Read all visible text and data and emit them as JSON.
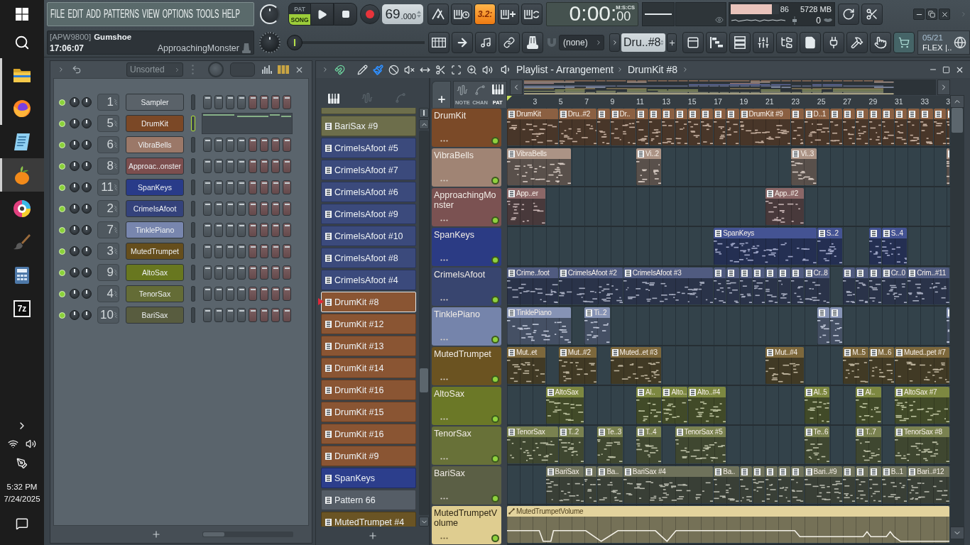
{
  "taskbar": {
    "apps": [
      {
        "kind": "folder",
        "running": true,
        "selected": false
      },
      {
        "kind": "globe",
        "running": true,
        "selected": false
      },
      {
        "kind": "notepad",
        "running": false,
        "selected": false
      },
      {
        "kind": "fruit",
        "running": true,
        "selected": true
      },
      {
        "kind": "disc",
        "running": false,
        "selected": false
      },
      {
        "kind": "brush",
        "running": false,
        "selected": false
      },
      {
        "kind": "calculator",
        "running": false,
        "selected": false
      },
      {
        "kind": "archive",
        "label": "7z",
        "running": false,
        "selected": false
      }
    ],
    "clock": {
      "time": "5:32 PM",
      "date": "7/24/2025"
    }
  },
  "menu": [
    "FILE",
    "EDIT",
    "ADD",
    "PATTERNS",
    "VIEW",
    "OPTIONS",
    "TOOLS",
    "HELP"
  ],
  "hint": {
    "code": "[APW9800]",
    "title": "Gumshoe",
    "time": "17:06:07",
    "channel": "ApproachingMonster"
  },
  "transport": {
    "modes": [
      {
        "label": "PAT",
        "selected": false
      },
      {
        "label": "SONG",
        "selected": true
      }
    ],
    "tempo": "69",
    "tempo_decimals": ".000"
  },
  "record_options": [
    {
      "kind": "metronome",
      "on": false
    },
    {
      "kind": "wait",
      "on": false
    },
    {
      "kind": "countdown",
      "label": "3.2:",
      "on": true
    },
    {
      "kind": "step",
      "on": false
    },
    {
      "kind": "loop",
      "on": false
    }
  ],
  "time_display": {
    "value": "0:00:",
    "centis": "00",
    "unit": "M:S:CS"
  },
  "monitor": {
    "cpu": {
      "reading": "86",
      "level": 0.86
    },
    "memory": "5728 MB",
    "polyphony": "0"
  },
  "song_position": {
    "level": 0
  },
  "snap": {
    "value": "(none)"
  },
  "pattern_selector": {
    "value": "Dru..#8"
  },
  "news": {
    "date": "05/21",
    "text": "FLEX |.."
  },
  "channel_rack": {
    "filter": "Unsorted",
    "view_toggles": [
      {
        "kind": "graph",
        "on": false
      },
      {
        "kind": "columns",
        "on": true
      }
    ],
    "channels": [
      {
        "name": "Sampler",
        "number": "1",
        "color": "#5a6269",
        "on": true,
        "selected": false,
        "kind": "steps"
      },
      {
        "name": "DrumKit",
        "number": "5",
        "color": "#7b4826",
        "on": true,
        "selected": true,
        "kind": "pianoroll"
      },
      {
        "name": "VibraBells",
        "number": "6",
        "color": "#9b7868",
        "on": true,
        "selected": false,
        "kind": "steps"
      },
      {
        "name": "Approac..onster",
        "number": "8",
        "color": "#7c4e4e",
        "on": true,
        "selected": false,
        "kind": "steps"
      },
      {
        "name": "SpanKeys",
        "number": "11",
        "color": "#293b89",
        "on": true,
        "selected": false,
        "kind": "steps"
      },
      {
        "name": "CrimeIsAfoot",
        "number": "2",
        "color": "#34427b",
        "on": true,
        "selected": false,
        "kind": "steps"
      },
      {
        "name": "TinklePiano",
        "number": "7",
        "color": "#7886ae",
        "on": true,
        "selected": false,
        "kind": "steps"
      },
      {
        "name": "MutedTrumpet",
        "number": "3",
        "color": "#654e1c",
        "on": true,
        "selected": false,
        "kind": "steps"
      },
      {
        "name": "AltoSax",
        "number": "9",
        "color": "#68771f",
        "on": true,
        "selected": false,
        "kind": "steps"
      },
      {
        "name": "TenorSax",
        "number": "4",
        "color": "#646c36",
        "on": true,
        "selected": false,
        "kind": "steps"
      },
      {
        "name": "BariSax",
        "number": "10",
        "color": "#585c3f",
        "on": true,
        "selected": false,
        "kind": "steps"
      }
    ]
  },
  "pattern_picker": {
    "tabs": [
      {
        "kind": "pattern",
        "selected": true
      },
      {
        "kind": "audio",
        "selected": false
      },
      {
        "kind": "automation",
        "selected": false
      }
    ],
    "patterns": [
      {
        "color": "#6d6e4b",
        "selected": false
      },
      {
        "name": "BariSax #9",
        "color": "#6d6e4b",
        "selected": false
      },
      {
        "name": "CrimeIsAfoot #5",
        "color": "#3b4a7c",
        "selected": false
      },
      {
        "name": "CrimeIsAfoot #7",
        "color": "#3b4a7c",
        "selected": false
      },
      {
        "name": "CrimeIsAfoot #6",
        "color": "#3b4a7c",
        "selected": false
      },
      {
        "name": "CrimeIsAfoot #9",
        "color": "#3b4a7c",
        "selected": false
      },
      {
        "name": "CrimeIsAfoot #10",
        "color": "#3b4a7c",
        "selected": false
      },
      {
        "name": "CrimeIsAfoot #8",
        "color": "#3b4a7c",
        "selected": false
      },
      {
        "name": "CrimeIsAfoot #4",
        "color": "#3b4a7c",
        "selected": false
      },
      {
        "name": "DrumKit #8",
        "color": "#8a5533",
        "selected": true
      },
      {
        "name": "DrumKit #12",
        "color": "#8a5533",
        "selected": false
      },
      {
        "name": "DrumKit #13",
        "color": "#8a5533",
        "selected": false
      },
      {
        "name": "DrumKit #14",
        "color": "#8a5533",
        "selected": false
      },
      {
        "name": "DrumKit #16",
        "color": "#8a5533",
        "selected": false
      },
      {
        "name": "DrumKit #15",
        "color": "#8a5533",
        "selected": false
      },
      {
        "name": "DrumKit #16",
        "color": "#8a5533",
        "selected": false
      },
      {
        "name": "DrumKit #9",
        "color": "#8a5533",
        "selected": false
      },
      {
        "name": "SpanKeys",
        "color": "#2c3e8c",
        "selected": false
      },
      {
        "name": "Pattern 66",
        "color": "#555d66",
        "selected": false
      },
      {
        "name": "MutedTrumpet #4",
        "color": "#6a5424",
        "selected": false
      }
    ]
  },
  "playlist": {
    "title": "Playlist - Arrangement",
    "pattern": "DrumKit #8",
    "snap_on": true,
    "tools": [
      {
        "kind": "draw",
        "selected": false
      },
      {
        "kind": "paint",
        "selected": true
      },
      {
        "kind": "delete",
        "selected": false
      },
      {
        "kind": "mute",
        "selected": false
      },
      {
        "kind": "slip",
        "selected": false
      },
      {
        "kind": "slice",
        "selected": false
      },
      {
        "kind": "select",
        "selected": false
      },
      {
        "kind": "zoom",
        "selected": false
      },
      {
        "kind": "playback",
        "selected": false
      }
    ],
    "view_tabs": [
      {
        "label": "NOTE",
        "selected": false
      },
      {
        "label": "CHAN",
        "selected": false
      },
      {
        "label": "PAT",
        "selected": true
      }
    ],
    "ruler": [
      "3",
      "5",
      "7",
      "9",
      "11",
      "13",
      "15",
      "17",
      "19",
      "21",
      "23",
      "25",
      "27",
      "29",
      "31",
      "33",
      "3"
    ],
    "tracks": [
      {
        "name": "DrumKit",
        "color": "#7b4a28",
        "on": true,
        "clips": [
          {
            "kind": "pattern",
            "label": "DrumKit"
          },
          {
            "kind": "pattern",
            "label": "Dru..#2"
          },
          {
            "kind": "pattern"
          },
          {
            "kind": "pattern",
            "label": "Dr.."
          },
          {
            "kind": "pattern"
          },
          {
            "kind": "pattern"
          },
          {
            "kind": "pattern"
          },
          {
            "kind": "pattern"
          },
          {
            "kind": "pattern"
          },
          {
            "kind": "pattern"
          },
          {
            "kind": "pattern"
          },
          {
            "kind": "pattern"
          },
          {
            "kind": "pattern",
            "label": "DrumKit #9"
          },
          {
            "kind": "pattern"
          },
          {
            "kind": "pattern",
            "label": "D..1"
          },
          {
            "kind": "pattern"
          },
          {
            "kind": "pattern"
          },
          {
            "kind": "pattern"
          },
          {
            "kind": "pattern"
          },
          {
            "kind": "pattern"
          },
          {
            "kind": "pattern"
          },
          {
            "kind": "pattern"
          },
          {
            "kind": "pattern"
          },
          {
            "kind": "pattern"
          },
          {
            "kind": "pattern"
          }
        ]
      },
      {
        "name": "VibraBells",
        "color": "#a08474",
        "on": true,
        "clips": [
          {
            "kind": "pattern",
            "label": "VibraBells"
          },
          {
            "kind": "pattern",
            "label": "Vi..2"
          },
          {
            "kind": "pattern",
            "label": "Vi..3"
          },
          {
            "kind": "pattern"
          }
        ]
      },
      {
        "name": "ApproachingMonster",
        "color": "#7b5252",
        "on": true,
        "clips": [
          {
            "kind": "pattern",
            "label": "App..er"
          },
          {
            "kind": "pattern",
            "label": "App..#2"
          }
        ]
      },
      {
        "name": "SpanKeys",
        "color": "#2b3b84",
        "on": true,
        "clips": [
          {
            "kind": "pattern",
            "label": "SpanKeys"
          },
          {
            "kind": "pattern",
            "label": "S..2"
          },
          {
            "kind": "pattern"
          },
          {
            "kind": "pattern",
            "label": "S..4"
          }
        ]
      },
      {
        "name": "CrimeIsAfoot",
        "color": "#38456f",
        "on": true,
        "clips": [
          {
            "kind": "pattern",
            "label": "Crime..foot"
          },
          {
            "kind": "pattern",
            "label": "CrimeIsAfoot #2"
          },
          {
            "kind": "pattern",
            "label": "CrimeIsAfoot #3"
          },
          {
            "kind": "pattern"
          },
          {
            "kind": "pattern"
          },
          {
            "kind": "pattern"
          },
          {
            "kind": "pattern"
          },
          {
            "kind": "pattern"
          },
          {
            "kind": "pattern"
          },
          {
            "kind": "pattern"
          },
          {
            "kind": "pattern",
            "label": "Cr..8"
          },
          {
            "kind": "pattern"
          },
          {
            "kind": "pattern"
          },
          {
            "kind": "pattern"
          },
          {
            "kind": "pattern",
            "label": "Cr..0"
          },
          {
            "kind": "pattern",
            "label": "Crim..#11"
          }
        ]
      },
      {
        "name": "TinklePiano",
        "color": "#7584ab",
        "on": true,
        "clips": [
          {
            "kind": "pattern",
            "label": "TinklePiano"
          },
          {
            "kind": "pattern",
            "label": "Ti..2"
          },
          {
            "kind": "pattern"
          },
          {
            "kind": "pattern"
          },
          {
            "kind": "pattern"
          }
        ]
      },
      {
        "name": "MutedTrumpet",
        "color": "#6b5321",
        "on": true,
        "clips": [
          {
            "kind": "pattern",
            "label": "Mut..et"
          },
          {
            "kind": "pattern",
            "label": "Mut..#2"
          },
          {
            "kind": "pattern",
            "label": "Muted..et #3"
          },
          {
            "kind": "pattern",
            "label": "Mut..#4"
          },
          {
            "kind": "pattern",
            "label": "M..5"
          },
          {
            "kind": "pattern",
            "label": "M..6"
          },
          {
            "kind": "pattern",
            "label": "Muted..pet #7"
          }
        ]
      },
      {
        "name": "AltoSax",
        "color": "#6b7827",
        "on": true,
        "clips": [
          {
            "kind": "pattern",
            "label": "AltoSax"
          },
          {
            "kind": "pattern",
            "label": "Al.."
          },
          {
            "kind": "pattern",
            "label": "Alto.."
          },
          {
            "kind": "pattern",
            "label": "Alto..#4"
          },
          {
            "kind": "pattern",
            "label": "Al..5"
          },
          {
            "kind": "pattern",
            "label": "Al.."
          },
          {
            "kind": "pattern",
            "label": "AltoSax #7"
          }
        ]
      },
      {
        "name": "TenorSax",
        "color": "#687138",
        "on": true,
        "clips": [
          {
            "kind": "pattern",
            "label": "TenorSax"
          },
          {
            "kind": "pattern",
            "label": "T..2"
          },
          {
            "kind": "pattern",
            "label": "Te..3"
          },
          {
            "kind": "pattern",
            "label": "T..4"
          },
          {
            "kind": "pattern",
            "label": "TenorSax #5"
          },
          {
            "kind": "pattern",
            "label": "Te..6"
          },
          {
            "kind": "pattern",
            "label": "T..7"
          },
          {
            "kind": "pattern",
            "label": "TenorSax #8"
          }
        ]
      },
      {
        "name": "BariSax",
        "color": "#5b5f45",
        "on": true,
        "clips": [
          {
            "kind": "pattern",
            "label": "BariSax"
          },
          {
            "kind": "pattern"
          },
          {
            "kind": "pattern",
            "label": "Ba.."
          },
          {
            "kind": "pattern",
            "label": "BariSax #4"
          },
          {
            "kind": "pattern",
            "label": "Ba.."
          },
          {
            "kind": "pattern"
          },
          {
            "kind": "pattern"
          },
          {
            "kind": "pattern"
          },
          {
            "kind": "pattern"
          },
          {
            "kind": "pattern"
          },
          {
            "kind": "pattern",
            "label": "Bari..#9"
          },
          {
            "kind": "pattern"
          },
          {
            "kind": "pattern"
          },
          {
            "kind": "pattern"
          },
          {
            "kind": "pattern",
            "label": "B..1"
          },
          {
            "kind": "pattern",
            "label": "Bari..#12"
          }
        ]
      },
      {
        "name": "MutedTrumpetVolume",
        "color": "#dfcd90",
        "on": true,
        "clips": [
          {
            "kind": "automation",
            "label": "MutedTrumpetVolume"
          }
        ]
      }
    ]
  }
}
